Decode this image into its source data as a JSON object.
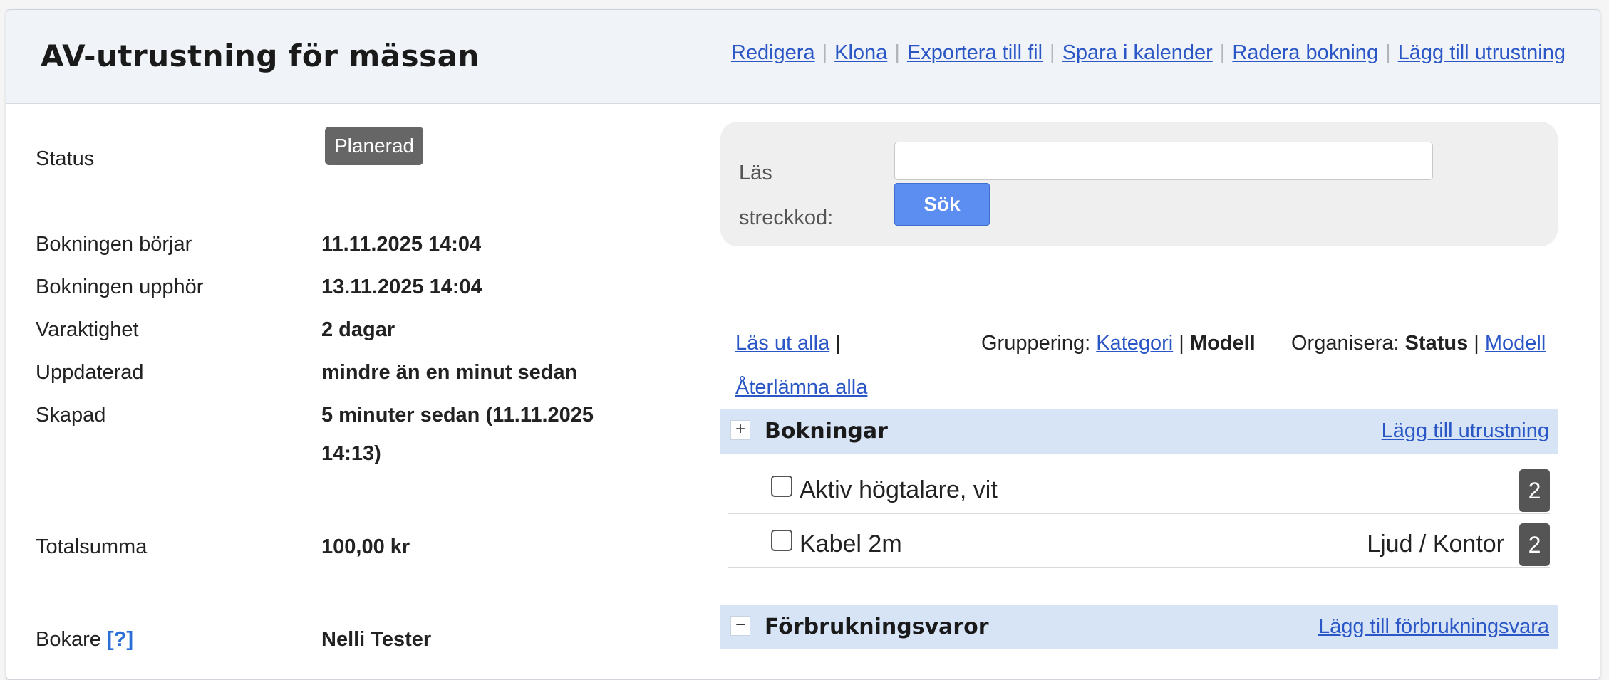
{
  "header": {
    "title": "AV-utrustning för mässan",
    "actions": [
      "Redigera",
      "Klona",
      "Exportera till fil",
      "Spara i kalender",
      "Radera bokning",
      "Lägg till utrustning"
    ]
  },
  "details": {
    "status_label": "Status",
    "status_value": "Planerad",
    "rows": [
      {
        "label": "Bokningen börjar",
        "value": "11.11.2025 14:04"
      },
      {
        "label": "Bokningen upphör",
        "value": "13.11.2025 14:04"
      },
      {
        "label": "Varaktighet",
        "value": "2 dagar"
      },
      {
        "label": "Uppdaterad",
        "value": "mindre än en minut sedan"
      },
      {
        "label": "Skapad",
        "value_line1": "5 minuter sedan (11.11.2025",
        "value_line2": "14:13)"
      }
    ],
    "total_label": "Totalsumma",
    "total_value": "100,00 kr",
    "booker_label": "Bokare",
    "booker_help": "[?]",
    "booker_value": "Nelli Tester"
  },
  "scan": {
    "label_line1": "Läs",
    "label_line2": "streckkod:",
    "input_value": "",
    "button_label": "Sök"
  },
  "toolbar": {
    "checkout_all": "Läs ut alla",
    "separator": "|",
    "return_all": "Återlämna alla",
    "grouping_label": "Gruppering:",
    "grouping_category": "Kategori",
    "grouping_model": "Modell",
    "organize_label": "Organisera:",
    "organize_status": "Status",
    "organize_model": "Modell"
  },
  "groups": [
    {
      "toggle": "+",
      "title": "Bokningar",
      "action": "Lägg till utrustning",
      "items": [
        {
          "name": "Aktiv högtalare, vit",
          "category": "",
          "qty": "2"
        },
        {
          "name": "Kabel 2m",
          "category": "Ljud / Kontor",
          "qty": "2"
        }
      ]
    },
    {
      "toggle": "−",
      "title": "Förbrukningsvaror",
      "action": "Lägg till förbrukningsvara"
    }
  ]
}
